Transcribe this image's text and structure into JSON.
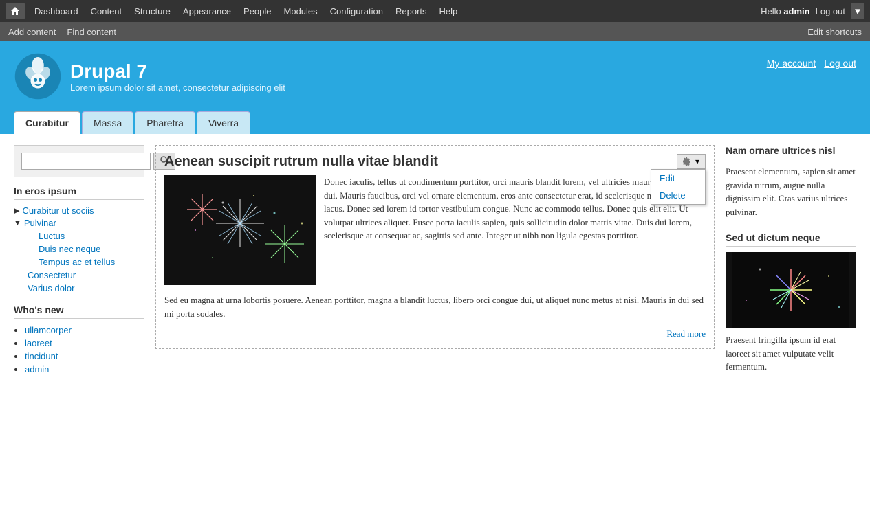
{
  "admin_toolbar": {
    "home_icon": "home",
    "nav_items": [
      "Dashboard",
      "Content",
      "Structure",
      "Appearance",
      "People",
      "Modules",
      "Configuration",
      "Reports",
      "Help"
    ],
    "hello_text": "Hello",
    "admin_name": "admin",
    "log_out_label": "Log out"
  },
  "shortcuts_bar": {
    "add_content": "Add content",
    "find_content": "Find content",
    "edit_shortcuts": "Edit shortcuts"
  },
  "header": {
    "site_name": "Drupal 7",
    "site_slogan": "Lorem ipsum dolor sit amet, consectetur adipiscing elit",
    "my_account": "My account",
    "log_out": "Log out"
  },
  "nav_tabs": [
    {
      "label": "Curabitur",
      "active": true
    },
    {
      "label": "Massa",
      "active": false
    },
    {
      "label": "Pharetra",
      "active": false
    },
    {
      "label": "Viverra",
      "active": false
    }
  ],
  "sidebar": {
    "search_placeholder": "",
    "search_btn_label": "🔍",
    "menu_title": "In eros ipsum",
    "menu_items": [
      {
        "label": "Curabitur ut sociis",
        "level": 1,
        "type": "collapsed"
      },
      {
        "label": "Pulvinar",
        "level": 1,
        "type": "expanded",
        "children": [
          {
            "label": "Luctus",
            "level": 2
          },
          {
            "label": "Duis nec neque",
            "level": 2
          },
          {
            "label": "Tempus ac et tellus",
            "level": 2
          }
        ]
      },
      {
        "label": "Consectetur",
        "level": 1
      },
      {
        "label": "Varius dolor",
        "level": 1
      }
    ],
    "whats_new_title": "Who's new",
    "whats_new_items": [
      "ullamcorper",
      "laoreet",
      "tincidunt",
      "admin"
    ]
  },
  "article": {
    "title": "Aenean suscipit rutrum nulla vitae blandit",
    "actions_btn": "⚙▾",
    "edit_label": "Edit",
    "delete_label": "Delete",
    "body_text": "Donec iaculis, tellus ut condimentum porttitor, orci mauris blandit lorem, vel ultricies mauris metus eu dui. Mauris faucibus, orci vel ornare elementum, eros ante consectetur erat, id scelerisque nulla metus a lacus. Donec sed lorem id tortor vestibulum congue. Nunc ac commodo tellus. Donec quis elit elit. Ut volutpat ultrices aliquet. Fusce porta iaculis sapien, quis sollicitudin dolor mattis vitae. Duis dui lorem, scelerisque at consequat ac, sagittis sed ante. Integer ut nibh non ligula egestas porttitor.",
    "full_text": "Sed eu magna at urna lobortis posuere. Aenean porttitor, magna a blandit luctus, libero orci congue dui, ut aliquet nunc metus at nisi. Mauris in dui sed mi porta sodales.",
    "read_more": "Read more"
  },
  "right_sidebar": {
    "block1_title": "Nam ornare ultrices nisl",
    "block1_text": "Praesent elementum, sapien sit amet gravida rutrum, augue nulla dignissim elit. Cras varius ultrices pulvinar.",
    "block2_title": "Sed ut dictum neque",
    "block2_text": "Praesent fringilla ipsum id erat laoreet sit amet vulputate velit fermentum."
  },
  "colors": {
    "admin_bg": "#333333",
    "shortcuts_bg": "#555555",
    "header_bg": "#29a8e0",
    "link_color": "#0074bd",
    "active_tab_bg": "#ffffff"
  }
}
